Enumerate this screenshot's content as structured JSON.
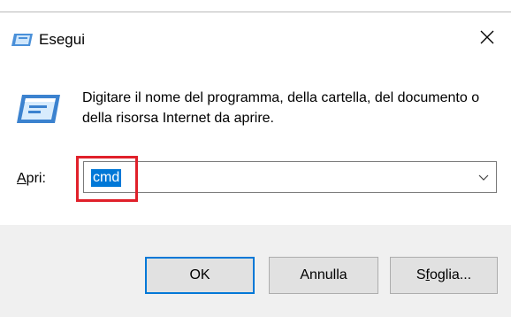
{
  "window": {
    "title": "Esegui"
  },
  "icons": {
    "title": "run-icon",
    "close": "close-icon",
    "big": "run-icon",
    "dropdown": "chevron-down-icon"
  },
  "description": "Digitare il nome del programma, della cartella, del documento o della risorsa Internet da aprire.",
  "open": {
    "label_prefix": "",
    "label_underlined": "A",
    "label_rest": "pri:",
    "value": "cmd"
  },
  "buttons": {
    "ok": "OK",
    "cancel": "Annulla",
    "browse_prefix": "S",
    "browse_underlined": "f",
    "browse_rest": "oglia..."
  },
  "colors": {
    "accent": "#0078d7",
    "highlight": "#e0202a",
    "footer": "#f0f0f0"
  }
}
